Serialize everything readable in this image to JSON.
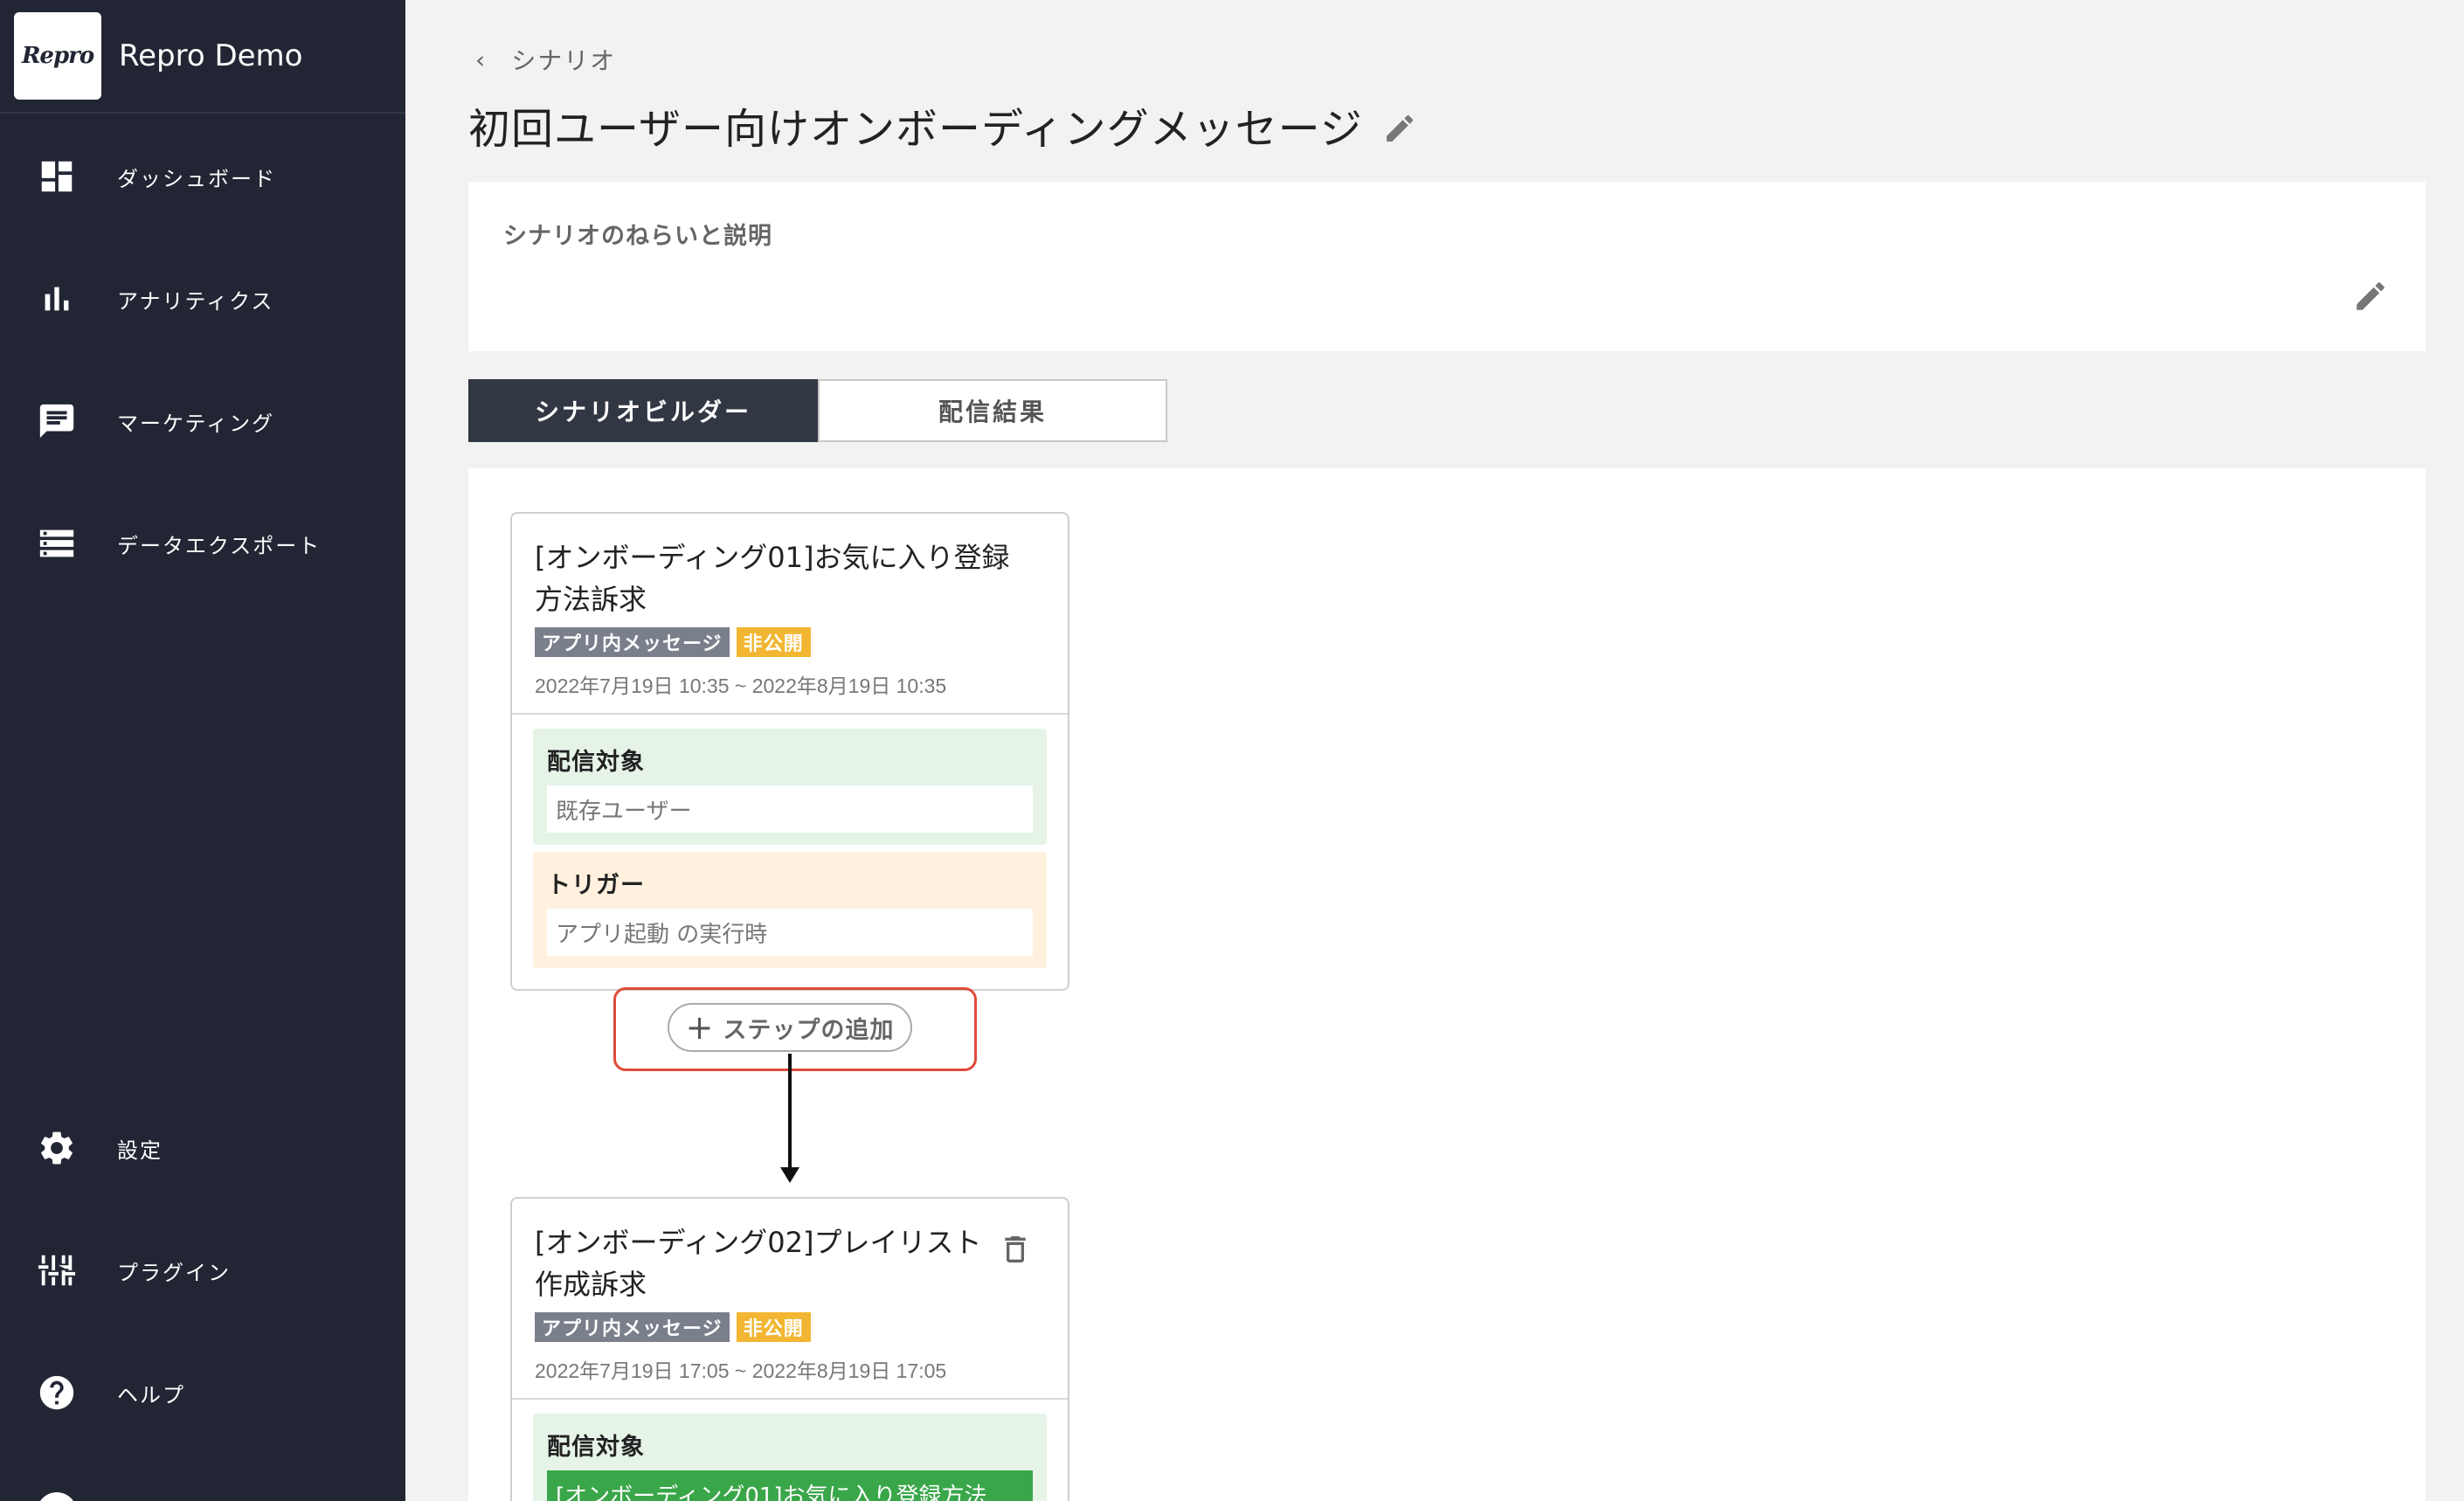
{
  "app": {
    "logo_text": "Repro",
    "name": "Repro Demo"
  },
  "sidebar": {
    "items": [
      {
        "label": "ダッシュボード",
        "icon": "dashboard-icon"
      },
      {
        "label": "アナリティクス",
        "icon": "bar-chart-icon"
      },
      {
        "label": "マーケティング",
        "icon": "message-icon"
      },
      {
        "label": "データエクスポート",
        "icon": "list-icon"
      },
      {
        "label": "設定",
        "icon": "gear-icon"
      },
      {
        "label": "プラグイン",
        "icon": "plugin-icon"
      },
      {
        "label": "ヘルプ",
        "icon": "help-icon"
      }
    ]
  },
  "breadcrumb": {
    "label": "シナリオ"
  },
  "page": {
    "title": "初回ユーザー向けオンボーディングメッセージ"
  },
  "description": {
    "label": "シナリオのねらいと説明"
  },
  "tabs": [
    {
      "label": "シナリオビルダー",
      "active": true
    },
    {
      "label": "配信結果",
      "active": false
    }
  ],
  "steps": [
    {
      "title": "[オンボーディング01]お気に入り登録方法訴求",
      "type_badge": "アプリ内メッセージ",
      "status_badge": "非公開",
      "period": "2022年7月19日 10:35 ~ 2022年8月19日 10:35",
      "target_label": "配信対象",
      "target_value": "既存ユーザー",
      "trigger_label": "トリガー",
      "trigger_value": "アプリ起動 の実行時"
    },
    {
      "title": "[オンボーディング02]プレイリスト作成訴求",
      "type_badge": "アプリ内メッセージ",
      "status_badge": "非公開",
      "period": "2022年7月19日 17:05 ~ 2022年8月19日 17:05",
      "target_label": "配信対象",
      "target_value": "[オンボーディング01]お気に入り登録方法"
    }
  ],
  "add_step": {
    "label": "ステップの追加"
  },
  "colors": {
    "sidebar_bg": "#222634",
    "active_tab_bg": "#323744",
    "target_bg": "#e6f4e8",
    "trigger_bg": "#fff1dd",
    "badge_type": "#7a7f8c",
    "badge_status": "#f2b632",
    "linked_target": "#3aa64a",
    "highlight": "#e04a3a"
  }
}
